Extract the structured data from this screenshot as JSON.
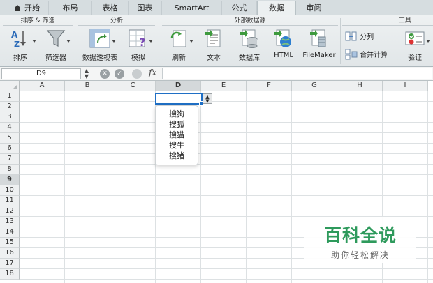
{
  "tabs": [
    {
      "label": "开始",
      "active": false
    },
    {
      "label": "布局",
      "active": false
    },
    {
      "label": "表格",
      "active": false
    },
    {
      "label": "图表",
      "active": false
    },
    {
      "label": "SmartArt",
      "active": false
    },
    {
      "label": "公式",
      "active": false
    },
    {
      "label": "数据",
      "active": true
    },
    {
      "label": "审阅",
      "active": false
    }
  ],
  "ribbon": {
    "groups": {
      "sort_filter": "排序 & 筛选",
      "analysis": "分析",
      "external": "外部数据源",
      "tools": "工具"
    },
    "buttons": {
      "sort": "排序",
      "filter": "筛选器",
      "pivot": "数据透视表",
      "whatif": "模拟",
      "refresh": "刷新",
      "text": "文本",
      "database": "数据库",
      "html": "HTML",
      "filemaker": "FileMaker",
      "split": "分列",
      "merge": "合并计算",
      "validate": "验证"
    },
    "sort_icon_text": "A Z",
    "html_icon_text": "HTML"
  },
  "formula_bar": {
    "name_box": "D9",
    "fx": "fx",
    "cancel_glyph": "✕",
    "confirm_glyph": "✓",
    "value": ""
  },
  "grid": {
    "columns": [
      "A",
      "B",
      "C",
      "D",
      "E",
      "F",
      "G",
      "H",
      "I"
    ],
    "selected_column": "D",
    "rows": [
      "1",
      "2",
      "3",
      "4",
      "5",
      "6",
      "7",
      "8",
      "9",
      "10",
      "11",
      "12",
      "13",
      "14",
      "15",
      "16",
      "17",
      "18"
    ],
    "selected_row": "9"
  },
  "dropdown": {
    "items": [
      "搜狗",
      "搜狐",
      "搜猫",
      "搜牛",
      "搜猪"
    ]
  },
  "watermark": {
    "title": "百科全说",
    "subtitle": "助你轻松解决"
  },
  "colors": {
    "accent": "#1f6fc5",
    "watermark_green": "#2e9a5c"
  }
}
